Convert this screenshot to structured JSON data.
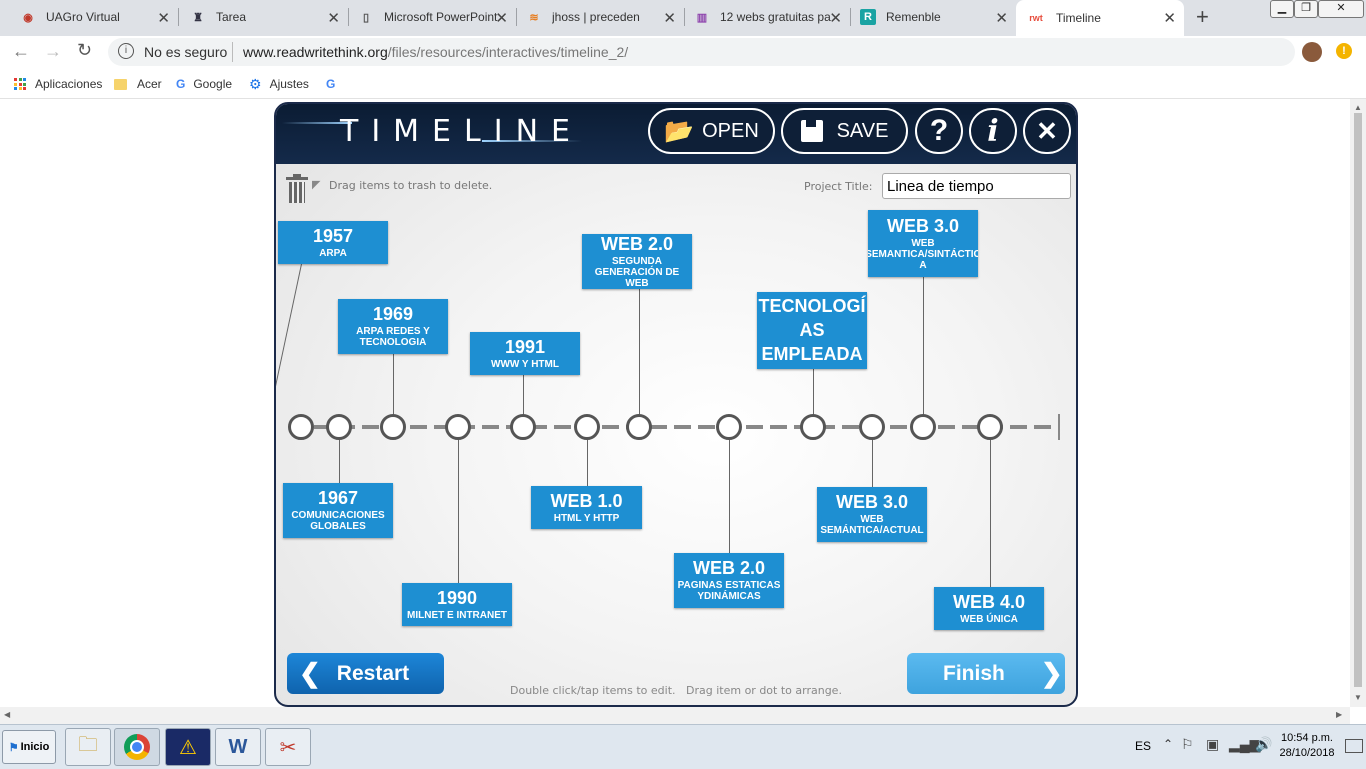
{
  "browser": {
    "tabs": [
      {
        "title": "UAGro Virtual",
        "icon": "uagro-icon"
      },
      {
        "title": "Tarea",
        "icon": "tarea-icon"
      },
      {
        "title": "Microsoft PowerPoint",
        "icon": "document-icon"
      },
      {
        "title": "jhoss | preceden",
        "icon": "preceden-icon"
      },
      {
        "title": "12 webs gratuitas pa",
        "icon": "books-icon"
      },
      {
        "title": "Remenble",
        "icon": "remenble-icon"
      },
      {
        "title": "Timeline",
        "icon": "rwt-icon",
        "favicon_text": "rwt"
      }
    ],
    "new_tab_symbol": "+",
    "close_symbol": "✕",
    "security_label": "No es seguro",
    "url_host": "www.readwritethink.org",
    "url_path": "/files/resources/interactives/timeline_2/",
    "bookmarks": [
      "Aplicaciones",
      "Acer",
      "Google",
      "Ajustes"
    ]
  },
  "app": {
    "title": "TIMELINE",
    "open_label": "OPEN",
    "save_label": "SAVE",
    "help_symbol": "?",
    "info_symbol": "i",
    "close_symbol": "✕",
    "trash_hint": "Drag items to trash to delete.",
    "project_title_label": "Project Title:",
    "project_title_value": "Linea de tiempo",
    "footer_hint": "Double click/tap items to edit.   Drag item or dot to arrange.",
    "restart_label": "Restart",
    "finish_label": "Finish",
    "colors": {
      "card": "#1e8fd2",
      "header": "#0b1c33",
      "finish": "#4fb1e6",
      "restart": "#1372c2"
    }
  },
  "timeline_items": [
    {
      "title": "1957",
      "subtitle": "ARPA"
    },
    {
      "title": "1967",
      "subtitle": "COMUNICACIONES GLOBALES"
    },
    {
      "title": "1969",
      "subtitle": "ARPA REDES Y TECNOLOGIA"
    },
    {
      "title": "1990",
      "subtitle": "MILNET E INTRANET"
    },
    {
      "title": "1991",
      "subtitle": "WWW Y HTML"
    },
    {
      "title": "WEB 1.0",
      "subtitle": "HTML Y HTTP"
    },
    {
      "title": "WEB 2.0",
      "subtitle": "SEGUNDA GENERACIÓN DE WEB"
    },
    {
      "title": "WEB 2.0",
      "subtitle": "PAGINAS ESTATICAS YDINÁMICAS"
    },
    {
      "title": "TECNOLOGÍ AS EMPLEADA",
      "subtitle": ""
    },
    {
      "title": "WEB 3.0",
      "subtitle": "WEB SEMÁNTICA/ACTUAL"
    },
    {
      "title": "WEB 3.0",
      "subtitle": "WEB SEMANTICA/SINTÁCTIC A"
    },
    {
      "title": "WEB 4.0",
      "subtitle": "WEB ÚNICA"
    }
  ],
  "taskbar": {
    "start_label": "Inicio",
    "language": "ES",
    "time": "10:54 p.m.",
    "date": "28/10/2018"
  }
}
